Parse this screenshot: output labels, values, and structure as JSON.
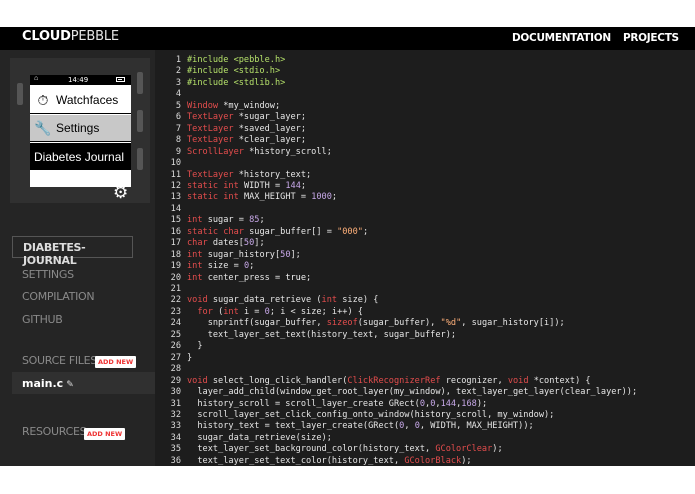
{
  "header": {
    "logo_bold": "CLOUD",
    "logo_light": "PEBBLE",
    "nav_documentation": "DOCUMENTATION",
    "nav_projects": "PROJECTS"
  },
  "watch": {
    "time": "14:49",
    "menu_watchfaces": "Watchfaces",
    "menu_settings": "Settings",
    "menu_app": "Diabetes Journal"
  },
  "sidebar": {
    "project_name": "DIABETES-JOURNAL",
    "settings": "SETTINGS",
    "compilation": "COMPILATION",
    "github": "GITHUB",
    "source_files": "SOURCE FILES",
    "add_new": "ADD NEW",
    "file_main": "main.c",
    "resources": "RESOURCES"
  },
  "code_lines": [
    "#include <pebble.h>",
    "#include <stdio.h>",
    "#include <stdlib.h>",
    "",
    "Window *my_window;",
    "TextLayer *sugar_layer;",
    "TextLayer *saved_layer;",
    "TextLayer *clear_layer;",
    "ScrollLayer *history_scroll;",
    "",
    "TextLayer *history_text;",
    "static int WIDTH = 144;",
    "static int MAX_HEIGHT = 1000;",
    "",
    "int sugar = 85;",
    "static char sugar_buffer[] = \"000\";",
    "char dates[50];",
    "int sugar_history[50];",
    "int size = 0;",
    "int center_press = true;",
    "",
    "void sugar_data_retrieve (int size) {",
    "  for (int i = 0; i < size; i++) {",
    "    snprintf(sugar_buffer, sizeof(sugar_buffer), \"%d\", sugar_history[i]);",
    "    text_layer_set_text(history_text, sugar_buffer);",
    "  }",
    "}",
    "",
    "void select_long_click_handler(ClickRecognizerRef recognizer, void *context) {",
    "  layer_add_child(window_get_root_layer(my_window), text_layer_get_layer(clear_layer));",
    "  history_scroll = scroll_layer_create GRect(0,0,144,168);",
    "  scroll_layer_set_click_config_onto_window(history_scroll, my_window);",
    "  history_text = text_layer_create(GRect(0, 0, WIDTH, MAX_HEIGHT));",
    "  sugar_data_retrieve(size);",
    "  text_layer_set_background_color(history_text, GColorClear);",
    "  text_layer_set_text_color(history_text, GColorBlack);"
  ],
  "colors": {
    "preprocessor": "#b4e06a",
    "keyword": "#e44d4d",
    "number": "#c7a8e8",
    "string": "#ffb07a",
    "add_button_text": "#e33333"
  },
  "icons": {
    "watchfaces": "stopwatch-icon",
    "settings": "wrench-icon",
    "gear": "gear-icon",
    "edit": "edit-icon"
  }
}
